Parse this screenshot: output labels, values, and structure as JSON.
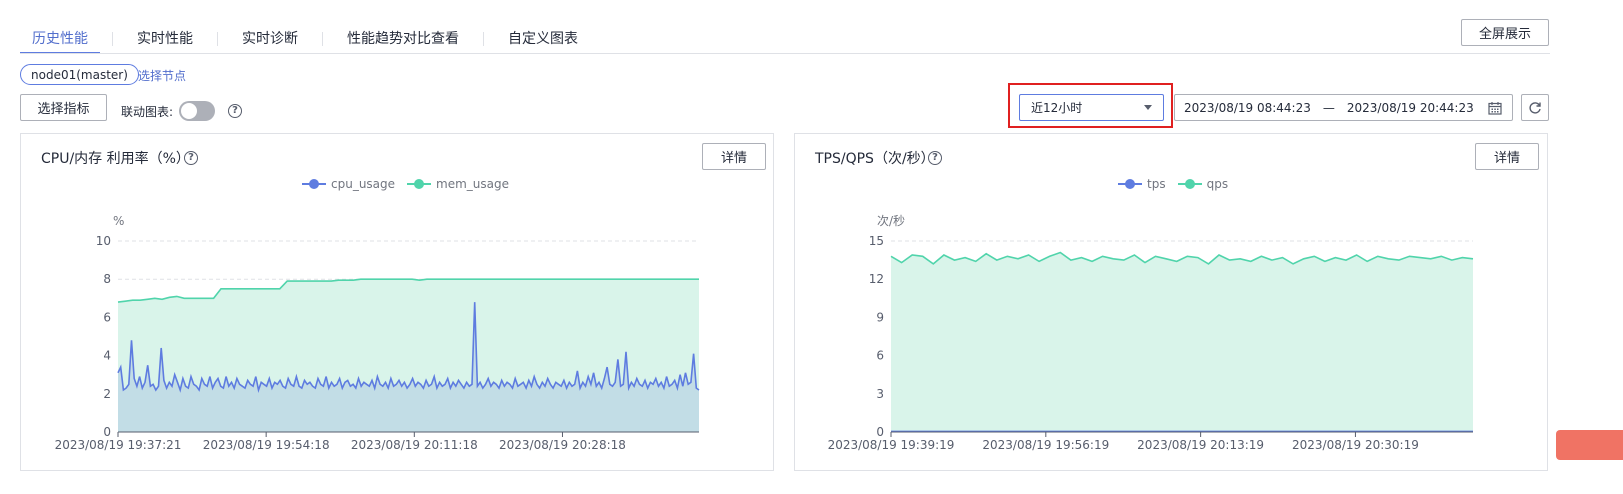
{
  "tabs": [
    {
      "label": "历史性能",
      "active": true
    },
    {
      "label": "实时性能",
      "active": false
    },
    {
      "label": "实时诊断",
      "active": false
    },
    {
      "label": "性能趋势对比查看",
      "active": false
    },
    {
      "label": "自定义图表",
      "active": false
    }
  ],
  "fullscreen_label": "全屏展示",
  "node": {
    "selected": "node01(master)",
    "select_link": "选择节点"
  },
  "toolbar": {
    "select_metric_label": "选择指标",
    "linked_chart_label": "联动图表:",
    "linked_chart_on": false,
    "time_range": "近12小时",
    "start_time": "2023/08/19 08:44:23",
    "separator": "—",
    "end_time": "2023/08/19 20:44:23"
  },
  "colors": {
    "accent": "#5e7ce0",
    "mint": "#50d4ab",
    "highlight_box": "#e02020"
  },
  "panels": [
    {
      "title": "CPU/内存 利用率（%）",
      "detail_label": "详情"
    },
    {
      "title": "TPS/QPS（次/秒）",
      "detail_label": "详情"
    }
  ],
  "chart_data": [
    {
      "type": "area",
      "title": "CPU/内存 利用率（%）",
      "ylabel": "%",
      "ylim": [
        0,
        10
      ],
      "yticks": [
        "0",
        "2",
        "4",
        "6",
        "8",
        "10"
      ],
      "x_ticks": [
        "2023/08/19 19:37:21",
        "2023/08/19 19:54:18",
        "2023/08/19 20:11:18",
        "2023/08/19 20:28:18"
      ],
      "x_tick_positions": [
        0,
        0.255,
        0.51,
        0.765
      ],
      "legend": "top-center",
      "grid": true,
      "series": [
        {
          "name": "cpu_usage",
          "color": "#5e7ce0",
          "fill": "#c2dde6",
          "values": [
            3.1,
            3.4,
            2.2,
            2.3,
            2.5,
            4.8,
            2.8,
            2.4,
            2.9,
            2.3,
            2.6,
            3.5,
            2.4,
            2.5,
            2.2,
            2.4,
            4.4,
            2.7,
            2.3,
            2.6,
            2.4,
            3.0,
            2.6,
            2.2,
            2.8,
            2.4,
            2.3,
            2.9,
            2.5,
            2.4,
            2.2,
            2.8,
            2.5,
            2.4,
            2.9,
            2.3,
            2.6,
            2.8,
            2.4,
            2.3,
            2.9,
            2.4,
            2.6,
            2.3,
            2.8,
            2.5,
            2.4,
            2.3,
            2.7,
            2.5,
            2.4,
            2.9,
            2.2,
            2.6,
            2.5,
            2.4,
            2.8,
            2.3,
            2.6,
            2.5,
            2.7,
            2.4,
            2.3,
            2.8,
            2.5,
            2.4,
            2.9,
            2.4,
            2.3,
            2.7,
            2.5,
            2.6,
            2.4,
            2.3,
            2.8,
            2.5,
            2.4,
            2.9,
            2.3,
            2.6,
            2.4,
            2.5,
            2.8,
            2.3,
            2.6,
            2.7,
            2.4,
            2.5,
            2.3,
            2.8,
            2.4,
            2.6,
            2.5,
            2.4,
            2.7,
            2.3,
            2.9,
            2.5,
            2.4,
            2.6,
            2.3,
            2.8,
            2.4,
            2.5,
            2.7,
            2.4,
            2.6,
            2.3,
            2.5,
            2.8,
            2.4,
            2.6,
            2.5,
            2.3,
            2.7,
            2.4,
            2.5,
            2.9,
            2.3,
            2.6,
            2.4,
            2.5,
            2.8,
            2.3,
            2.6,
            2.4,
            2.7,
            2.5,
            2.3,
            2.6,
            2.4,
            2.5,
            6.8,
            2.4,
            2.6,
            2.3,
            2.5,
            2.8,
            2.4,
            2.6,
            2.5,
            2.3,
            2.7,
            2.4,
            2.6,
            2.5,
            2.3,
            2.8,
            2.4,
            2.5,
            2.6,
            2.3,
            2.7,
            2.4,
            2.9,
            2.5,
            2.3,
            2.6,
            2.4,
            2.8,
            2.5,
            2.3,
            2.6,
            2.5,
            2.4,
            2.7,
            2.3,
            2.6,
            2.4,
            2.5,
            3.2,
            2.3,
            2.6,
            2.4,
            2.9,
            2.5,
            3.1,
            2.4,
            2.6,
            2.3,
            2.8,
            3.4,
            2.5,
            2.4,
            2.6,
            3.8,
            2.4,
            2.5,
            4.2,
            2.3,
            2.6,
            2.4,
            2.8,
            2.5,
            2.4,
            2.7,
            2.3,
            2.6,
            2.5,
            2.8,
            2.4,
            2.6,
            2.3,
            2.9,
            2.4,
            2.5,
            2.7,
            2.3,
            3.0,
            2.4,
            3.1,
            2.5,
            2.6,
            4.1,
            2.3,
            2.2
          ]
        },
        {
          "name": "mem_usage",
          "color": "#50d4ab",
          "fill": "#d9f4ea",
          "values": [
            6.8,
            6.85,
            6.9,
            6.9,
            6.95,
            7.0,
            6.95,
            7.05,
            7.1,
            7.0,
            7.0,
            7.0,
            7.0,
            7.0,
            7.5,
            7.5,
            7.5,
            7.5,
            7.5,
            7.5,
            7.5,
            7.5,
            7.5,
            7.9,
            7.9,
            7.9,
            7.9,
            7.9,
            7.9,
            7.9,
            7.95,
            7.95,
            7.95,
            8.0,
            8.0,
            8.0,
            8.0,
            8.0,
            8.0,
            8.0,
            8.0,
            7.95,
            8.0,
            8.0,
            8.0,
            8.0,
            8.0,
            8.0,
            8.0,
            8.0,
            8.0,
            8.0,
            8.0,
            8.0,
            8.0,
            8.0,
            8.0,
            8.0,
            8.0,
            8.0,
            8.0,
            8.0,
            8.0,
            8.0,
            8.0,
            8.0,
            8.0,
            8.0,
            8.0,
            8.0,
            8.0,
            8.0,
            8.0,
            8.0,
            8.0,
            8.0,
            8.0,
            8.0,
            8.0,
            8.0
          ]
        }
      ]
    },
    {
      "type": "area",
      "title": "TPS/QPS（次/秒）",
      "ylabel": "次/秒",
      "ylim": [
        0,
        15
      ],
      "yticks": [
        "0",
        "3",
        "6",
        "9",
        "12",
        "15"
      ],
      "x_ticks": [
        "2023/08/19 19:39:19",
        "2023/08/19 19:56:19",
        "2023/08/19 20:13:19",
        "2023/08/19 20:30:19"
      ],
      "x_tick_positions": [
        0,
        0.266,
        0.532,
        0.798
      ],
      "legend": "top-center",
      "grid": true,
      "series": [
        {
          "name": "tps",
          "color": "#5e7ce0",
          "fill": "none",
          "values": [
            0.05,
            0.05,
            0.05,
            0.05,
            0.05,
            0.05,
            0.05,
            0.05,
            0.05,
            0.05,
            0.05,
            0.05,
            0.05,
            0.05,
            0.05,
            0.05,
            0.05,
            0.05,
            0.05,
            0.05
          ]
        },
        {
          "name": "qps",
          "color": "#50d4ab",
          "fill": "#d9f4ea",
          "values": [
            13.8,
            13.3,
            13.9,
            13.8,
            13.2,
            13.9,
            13.5,
            13.7,
            13.4,
            14.0,
            13.5,
            13.8,
            13.6,
            13.9,
            13.4,
            13.8,
            14.1,
            13.5,
            13.7,
            13.4,
            13.8,
            13.6,
            13.5,
            13.9,
            13.3,
            13.8,
            13.6,
            13.4,
            13.8,
            13.7,
            13.2,
            13.9,
            13.5,
            13.6,
            13.4,
            13.8,
            13.5,
            13.7,
            13.2,
            13.6,
            13.8,
            13.4,
            13.7,
            13.5,
            13.9,
            13.4,
            13.8,
            13.6,
            13.5,
            13.8,
            13.7,
            13.6,
            13.8,
            13.5,
            13.7,
            13.6
          ]
        }
      ]
    }
  ]
}
